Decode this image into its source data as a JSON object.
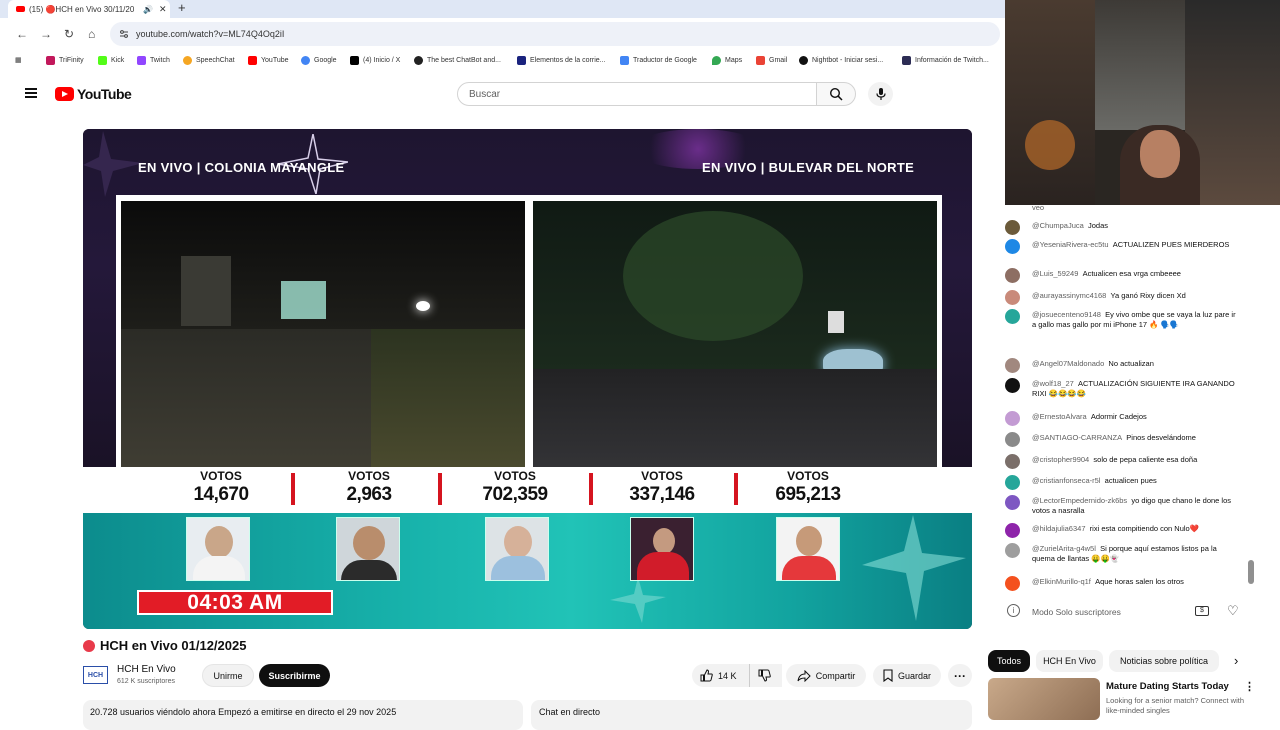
{
  "browser": {
    "tab_title": "(15) 🔴HCH en Vivo 30/11/20",
    "url": "youtube.com/watch?v=ML74Q4Oq2iI",
    "bookmarks": [
      "TriFinity",
      "Kick",
      "Twitch",
      "SpeechChat",
      "YouTube",
      "Google",
      "(4) Inicio / X",
      "The best ChatBot and...",
      "Elementos de la corrie...",
      "Traductor de Google",
      "Maps",
      "Gmail",
      "Nightbot - Iniciar sesi...",
      "Información de Twitch..."
    ]
  },
  "header": {
    "logo_text": "YouTube",
    "search_placeholder": "Buscar"
  },
  "video": {
    "left_cam_title": "EN VIVO | COLONIA MAYANGLE",
    "right_cam_title": "EN VIVO | BULEVAR DEL NORTE",
    "votes_label": "VOTOS",
    "votes": [
      "14,670",
      "2,963",
      "702,359",
      "337,146",
      "695,213"
    ],
    "clock": "04:03 AM"
  },
  "meta": {
    "title": "HCH en Vivo 01/12/2025",
    "channel_logo": "HCH",
    "channel_name": "HCH En Vivo",
    "subscribers": "612 K suscriptores",
    "join_label": "Unirme",
    "subscribe_label": "Suscribirme",
    "likes": "14 K",
    "share_label": "Compartir",
    "save_label": "Guardar",
    "viewing_text": "20.728 usuarios viéndolo ahora  Empezó a emitirse en directo el 29 nov 2025",
    "chat_label": "Chat en directo"
  },
  "chat": {
    "top_fragment": "veo",
    "messages": [
      {
        "author": "@ChumpaJuca",
        "text": "Jodas",
        "color": "#6b5a3a"
      },
      {
        "author": "@YeseniaRivera-ec5tu",
        "text": "ACTUALIZEN PUES MIERDEROS",
        "color": "#1e88e5"
      },
      {
        "author": "@Luis_59249",
        "text": "Actualicen esa vrga cmbeeee",
        "color": "#8d6e63"
      },
      {
        "author": "@aurayassinymc4168",
        "text": "Ya ganó Rixy dicen Xd",
        "color": "#c98a7a"
      },
      {
        "author": "@josuecenteno9148",
        "text": "Ey vivo ombe que se vaya la luz pare ir a gallo mas gallo por mi iPhone 17 🔥 🗣️🗣️",
        "color": "#26a69a"
      },
      {
        "author": "@Angel07Maldonado",
        "text": "No actualizan",
        "color": "#a1887f"
      },
      {
        "author": "@wolf18_27",
        "text": "ACTUALIZACIÓN SIGUIENTE IRA GANANDO RIXI 😂😂😂😂",
        "color": "#111111"
      },
      {
        "author": "@ErnestoAlvara",
        "text": "Adormir Cadejos",
        "color": "#c39bd3"
      },
      {
        "author": "@SANTIAGO-CARRANZA",
        "text": "Pinos desvelándome",
        "color": "#8a8a8a"
      },
      {
        "author": "@cristopher9904",
        "text": "solo de pepa caliente esa doña",
        "color": "#7b6f6a"
      },
      {
        "author": "@cristianfonseca-r5l",
        "text": "actualicen pues",
        "color": "#26a69a"
      },
      {
        "author": "@LectorEmpedernido-zk6bs",
        "text": "yo digo que chano le done los votos a nasralla",
        "color": "#7e57c2"
      },
      {
        "author": "@hildajulia6347",
        "text": "rixi esta compitiendo con Nulo❤️",
        "color": "#8e24aa"
      },
      {
        "author": "@ZurielArita-g4w5l",
        "text": "Si porque aquí estamos listos pa la quema de llantas 🤑🤑👻",
        "color": "#9e9e9e"
      },
      {
        "author": "@ElkinMurillo-q1f",
        "text": "Aque horas salen los otros",
        "color": "#f4511e"
      }
    ],
    "footer_text": "Modo Solo suscriptores"
  },
  "sidebar": {
    "chips": [
      "Todos",
      "HCH En Vivo",
      "Noticias sobre política"
    ],
    "ad_title": "Mature Dating Starts Today",
    "ad_sub": "Looking for a senior match? Connect with like-minded singles"
  }
}
